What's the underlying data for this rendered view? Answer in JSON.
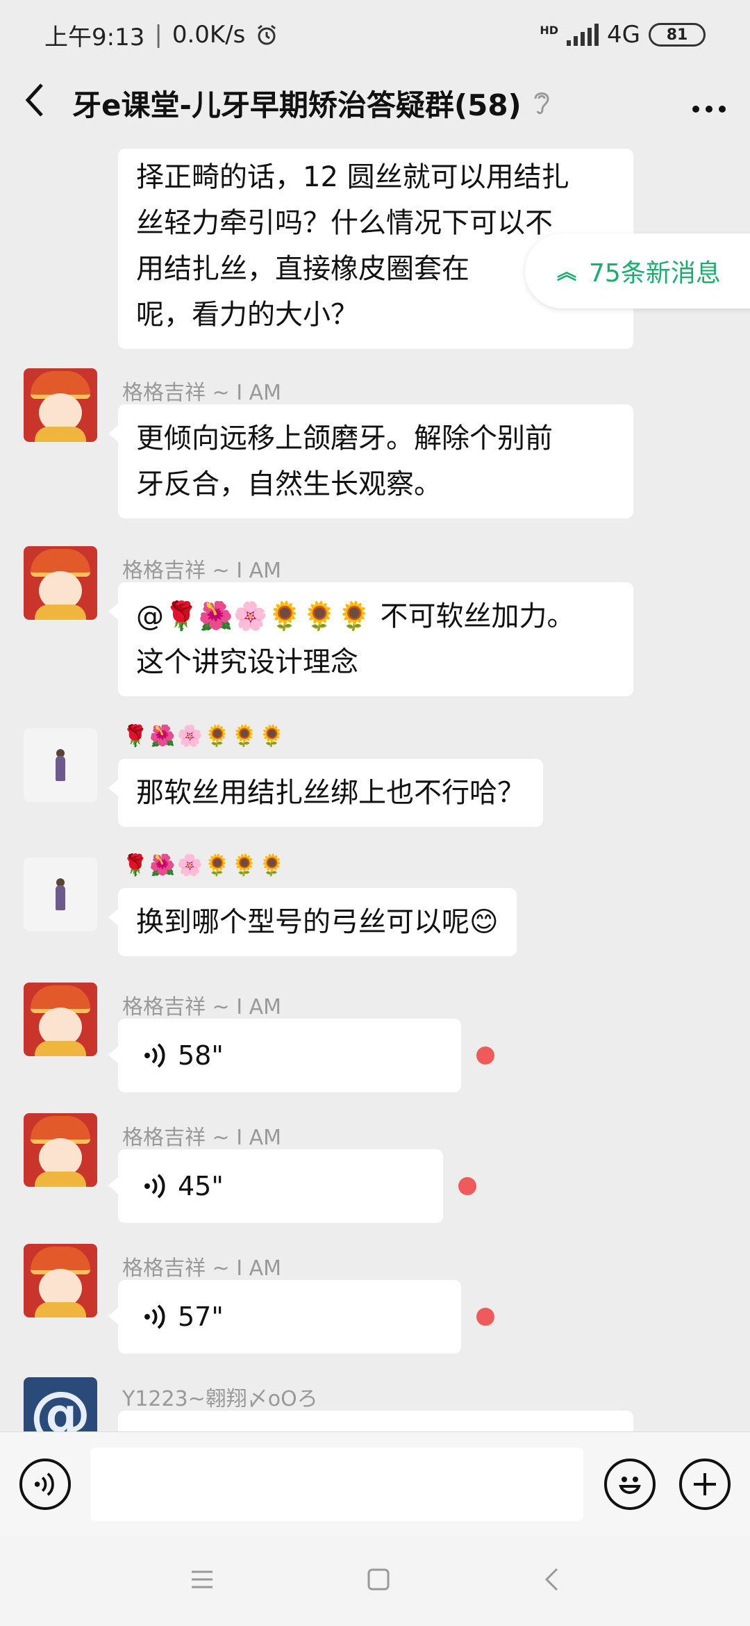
{
  "status": {
    "time": "上午9:13",
    "separator": "|",
    "speed": "0.0K/s",
    "network": "4G",
    "hd": "HD",
    "battery": "81"
  },
  "header": {
    "title": "牙e课堂-儿牙早期矫治答疑群(58)"
  },
  "new_messages": {
    "label": "75条新消息"
  },
  "messages": [
    {
      "text_lines": [
        "择正畸的话，12 圆丝就可以用结扎",
        "丝轻力牵引吗？什么情况下可以不",
        "用结扎丝，直接橡皮圈套在",
        "呢，看力的大小？"
      ]
    },
    {
      "sender": "格格吉祥 ~ I AM",
      "text_lines": [
        "更倾向远移上颌磨牙。解除个别前",
        "牙反合，自然生长观察。"
      ]
    },
    {
      "sender": "格格吉祥 ~ I AM",
      "text_lines": [
        "@🌹🌺🌸🌻🌻🌻  不可软丝加力。",
        "这个讲究设计理念"
      ]
    },
    {
      "sender": "🌹🌺🌸🌻🌻🌻",
      "text_lines": [
        "那软丝用结扎丝绑上也不行哈？"
      ]
    },
    {
      "sender": "🌹🌺🌸🌻🌻🌻",
      "text_lines": [
        "换到哪个型号的弓丝可以呢😊"
      ]
    },
    {
      "sender": "格格吉祥 ~ I AM",
      "voice": "58\""
    },
    {
      "sender": "格格吉祥 ~ I AM",
      "voice": "45\""
    },
    {
      "sender": "格格吉祥 ~ I AM",
      "voice": "57\""
    },
    {
      "sender": "Y1223~翱翔〆oOろ",
      "avatar_text": "@"
    }
  ],
  "input": {
    "placeholder": ""
  },
  "colors": {
    "accent": "#1aad6f",
    "unread": "#f05a5a",
    "background": "#ededed"
  },
  "icons": [
    "back-icon",
    "ear-icon",
    "more-icon",
    "voice-input-icon",
    "emoji-icon",
    "plus-icon",
    "menu-icon",
    "home-icon",
    "back-nav-icon"
  ]
}
